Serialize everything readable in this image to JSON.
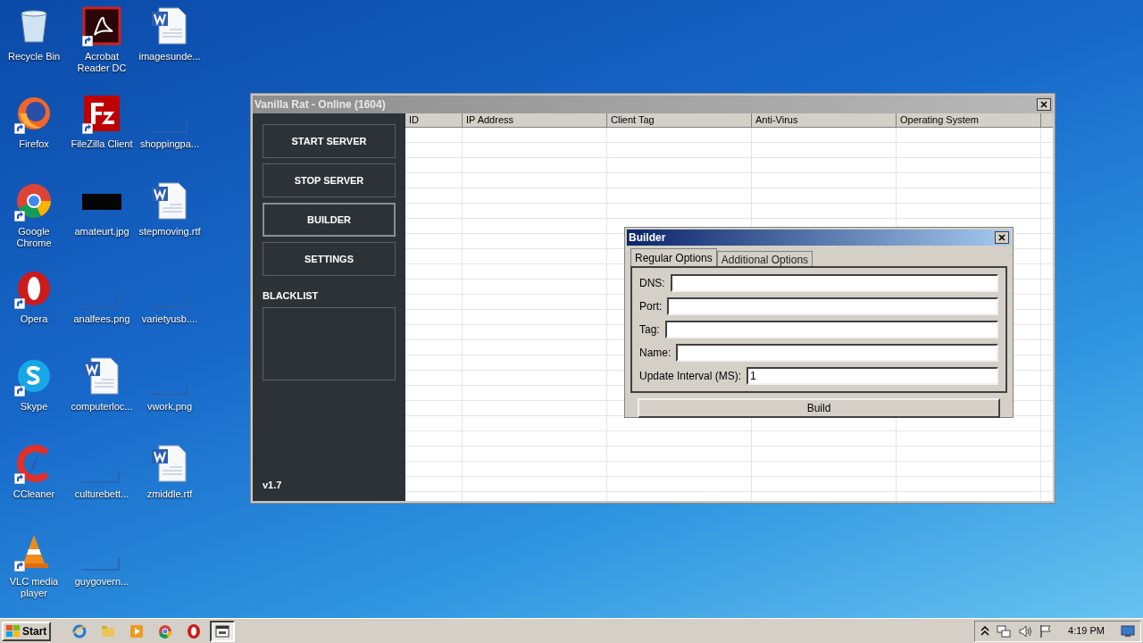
{
  "desktop_icons": [
    {
      "label": "Recycle Bin",
      "kind": "recycle",
      "shortcut": false
    },
    {
      "label": "Firefox",
      "kind": "firefox",
      "shortcut": true
    },
    {
      "label": "Google Chrome",
      "kind": "chrome",
      "shortcut": true
    },
    {
      "label": "Opera",
      "kind": "opera",
      "shortcut": true
    },
    {
      "label": "Skype",
      "kind": "skype",
      "shortcut": true
    },
    {
      "label": "CCleaner",
      "kind": "ccleaner",
      "shortcut": true
    },
    {
      "label": "VLC media player",
      "kind": "vlc",
      "shortcut": true
    },
    {
      "label": "Acrobat Reader DC",
      "kind": "acrobat",
      "shortcut": true
    },
    {
      "label": "FileZilla Client",
      "kind": "filezilla",
      "shortcut": true
    },
    {
      "label": "amateurt.jpg",
      "kind": "dark-image",
      "shortcut": false
    },
    {
      "label": "analfees.png",
      "kind": "blank-image",
      "shortcut": false
    },
    {
      "label": "computerloc...",
      "kind": "word",
      "shortcut": false
    },
    {
      "label": "culturebett...",
      "kind": "blank-image",
      "shortcut": false
    },
    {
      "label": "guygovern...",
      "kind": "blank-image",
      "shortcut": false
    },
    {
      "label": "imagesunde...",
      "kind": "word",
      "shortcut": false
    },
    {
      "label": "shoppingpa...",
      "kind": "blank-image",
      "shortcut": false
    },
    {
      "label": "stepmoving.rtf",
      "kind": "word",
      "shortcut": false
    },
    {
      "label": "varietyusb....",
      "kind": "blank-image",
      "shortcut": false
    },
    {
      "label": "vwork.png",
      "kind": "blank-image",
      "shortcut": false
    },
    {
      "label": "zmiddle.rtf",
      "kind": "word",
      "shortcut": false
    }
  ],
  "main_window": {
    "title": "Vanilla Rat - Online (1604)",
    "sidebar": {
      "buttons": [
        {
          "label": "START SERVER",
          "selected": false
        },
        {
          "label": "STOP SERVER",
          "selected": false
        },
        {
          "label": "BUILDER",
          "selected": true
        },
        {
          "label": "SETTINGS",
          "selected": false
        }
      ],
      "blacklist_label": "BLACKLIST",
      "version": "v1.7"
    },
    "table": {
      "columns": [
        "ID",
        "IP Address",
        "Client Tag",
        "Anti-Virus",
        "Operating System"
      ]
    }
  },
  "builder_dialog": {
    "title": "Builder",
    "tabs": [
      {
        "label": "Regular Options",
        "selected": true
      },
      {
        "label": "Additional Options",
        "selected": false
      }
    ],
    "fields": [
      {
        "label": "DNS:"
      },
      {
        "label": "Port:"
      },
      {
        "label": "Tag:"
      },
      {
        "label": "Name:"
      },
      {
        "label": "Update Interval (MS):",
        "value": "1"
      }
    ],
    "build_button": "Build"
  },
  "taskbar": {
    "start": "Start",
    "apps": [
      {
        "kind": "ie",
        "selected": false
      },
      {
        "kind": "explorer",
        "selected": false
      },
      {
        "kind": "media",
        "selected": false
      },
      {
        "kind": "chrome",
        "selected": false
      },
      {
        "kind": "opera",
        "selected": false
      },
      {
        "kind": "app",
        "selected": true
      }
    ],
    "time": "4:19 PM"
  }
}
